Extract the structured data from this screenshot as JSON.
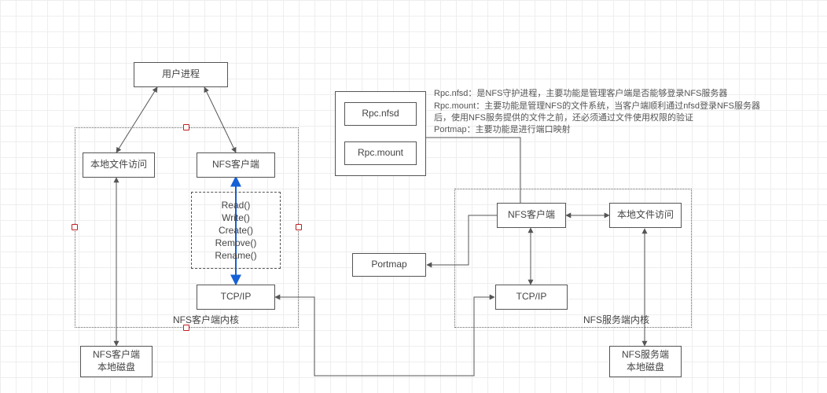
{
  "left": {
    "userProcess": "用户进程",
    "localFile": "本地文件访问",
    "nfsClient": "NFS客户端",
    "rpcOps": "Read()\nWrite()\nCreate()\nRemove()\nRename()",
    "tcpip": "TCP/IP",
    "kernelLabel": "NFS客户端内核",
    "disk": "NFS客户端\n本地磁盘"
  },
  "right": {
    "rpcNfsd": "Rpc.nfsd",
    "rpcMount": "Rpc.mount",
    "nfsClient": "NFS客户端",
    "localFile": "本地文件访问",
    "portmap": "Portmap",
    "tcpip": "TCP/IP",
    "kernelLabel": "NFS服务端内核",
    "disk": "NFS服务端\n本地磁盘"
  },
  "notes": {
    "line1": "Rpc.nfsd：是NFS守护进程，主要功能是管理客户端是否能够登录NFS服务器",
    "line2": "Rpc.mount：主要功能是管理NFS的文件系统，当客户端顺利通过nfsd登录NFS服务器后，使用NFS服务提供的文件之前，还必须通过文件使用权限的验证",
    "line3": "Portmap：主要功能是进行端口映射"
  },
  "chart_data": {
    "type": "diagram",
    "title": "NFS architecture (client & server)",
    "nodes": [
      {
        "id": "userProcess",
        "label": "用户进程",
        "group": "client-user"
      },
      {
        "id": "localFileL",
        "label": "本地文件访问",
        "group": "client-kernel"
      },
      {
        "id": "nfsClientL",
        "label": "NFS客户端",
        "group": "client-kernel"
      },
      {
        "id": "rpcOps",
        "label": "Read()/Write()/Create()/Remove()/Rename()",
        "group": "client-kernel",
        "style": "dashed"
      },
      {
        "id": "tcpipL",
        "label": "TCP/IP",
        "group": "client-kernel"
      },
      {
        "id": "diskL",
        "label": "NFS客户端 本地磁盘",
        "group": "client-disk"
      },
      {
        "id": "rpcNfsd",
        "label": "Rpc.nfsd",
        "group": "server-daemons"
      },
      {
        "id": "rpcMount",
        "label": "Rpc.mount",
        "group": "server-daemons"
      },
      {
        "id": "portmap",
        "label": "Portmap",
        "group": "server-daemons"
      },
      {
        "id": "nfsClientR",
        "label": "NFS客户端",
        "group": "server-kernel"
      },
      {
        "id": "localFileR",
        "label": "本地文件访问",
        "group": "server-kernel"
      },
      {
        "id": "tcpipR",
        "label": "TCP/IP",
        "group": "server-kernel"
      },
      {
        "id": "diskR",
        "label": "NFS服务端 本地磁盘",
        "group": "server-disk"
      }
    ],
    "groups": [
      {
        "id": "client-kernel",
        "label": "NFS客户端内核",
        "style": "dotted"
      },
      {
        "id": "server-kernel",
        "label": "NFS服务端内核",
        "style": "dotted"
      },
      {
        "id": "server-daemons",
        "style": "solid"
      }
    ],
    "edges": [
      {
        "from": "userProcess",
        "to": "localFileL",
        "bidir": true
      },
      {
        "from": "userProcess",
        "to": "nfsClientL",
        "bidir": true
      },
      {
        "from": "nfsClientL",
        "to": "tcpipL",
        "bidir": true,
        "via": "rpcOps",
        "color": "blue"
      },
      {
        "from": "localFileL",
        "to": "diskL",
        "bidir": true
      },
      {
        "from": "tcpipL",
        "to": "tcpipR",
        "bidir": true
      },
      {
        "from": "tcpipR",
        "to": "nfsClientR",
        "bidir": true
      },
      {
        "from": "nfsClientR",
        "to": "localFileR",
        "bidir": true
      },
      {
        "from": "localFileR",
        "to": "diskR",
        "bidir": true
      },
      {
        "from": "nfsClientR",
        "to": "rpcNfsd",
        "dir": "to"
      },
      {
        "from": "nfsClientR",
        "to": "portmap",
        "dir": "to"
      }
    ],
    "annotations": [
      "Rpc.nfsd：是NFS守护进程，主要功能是管理客户端是否能够登录NFS服务器",
      "Rpc.mount：主要功能是管理NFS的文件系统，当客户端顺利通过nfsd登录NFS服务器后，使用NFS服务提供的文件之前，还必须通过文件使用权限的验证",
      "Portmap：主要功能是进行端口映射"
    ]
  }
}
